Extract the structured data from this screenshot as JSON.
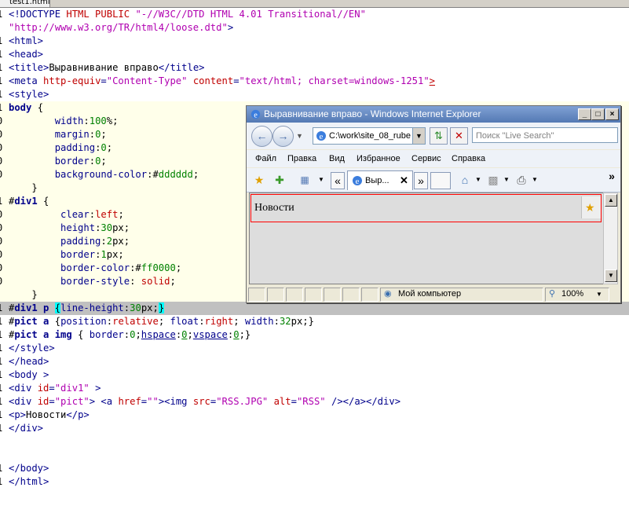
{
  "editor": {
    "tab_label": "test1.html",
    "lines": [
      {
        "n": "1",
        "p": [
          {
            "c": "t",
            "v": "<!DOCTYPE "
          },
          {
            "c": "a",
            "v": "HTML PUBLIC "
          },
          {
            "c": "s",
            "v": "\"-//W3C//DTD HTML 4.01 Transitional//EN\""
          }
        ]
      },
      {
        "n": "",
        "p": [
          {
            "c": "s",
            "v": "\"http://www.w3.org/TR/html4/loose.dtd\""
          },
          {
            "c": "t",
            "v": ">"
          }
        ]
      },
      {
        "n": "1",
        "p": [
          {
            "c": "t",
            "v": "<html>"
          }
        ]
      },
      {
        "n": "1",
        "p": [
          {
            "c": "t",
            "v": "<head>"
          }
        ]
      },
      {
        "n": "1",
        "p": [
          {
            "c": "t",
            "v": "<title>"
          },
          {
            "c": "",
            "v": "Выравнивание вправо"
          },
          {
            "c": "t",
            "v": "</title>"
          }
        ]
      },
      {
        "n": "1",
        "p": [
          {
            "c": "t",
            "v": "<meta "
          },
          {
            "c": "a",
            "v": "http-equiv"
          },
          {
            "c": "t",
            "v": "="
          },
          {
            "c": "s",
            "v": "\"Content-Type\" "
          },
          {
            "c": "a",
            "v": "content"
          },
          {
            "c": "t",
            "v": "="
          },
          {
            "c": "s",
            "v": "\"text/html; charset=windows-1251\""
          },
          {
            "c": "a ul",
            "v": ">"
          }
        ]
      },
      {
        "n": "1",
        "p": [
          {
            "c": "t",
            "v": "<style>"
          }
        ]
      },
      {
        "n": "1",
        "bg": "hlbg",
        "p": [
          {
            "c": "k",
            "v": "body"
          },
          {
            "c": "",
            "v": " {"
          }
        ]
      },
      {
        "n": "0",
        "bg": "hlbg",
        "p": [
          {
            "c": "t",
            "v": "        width"
          },
          {
            "c": "",
            "v": ":"
          },
          {
            "c": "g",
            "v": "100"
          },
          {
            "c": "",
            "v": "%;"
          }
        ]
      },
      {
        "n": "0",
        "bg": "hlbg",
        "p": [
          {
            "c": "t",
            "v": "        margin"
          },
          {
            "c": "",
            "v": ":"
          },
          {
            "c": "g",
            "v": "0"
          },
          {
            "c": "",
            "v": ";"
          }
        ]
      },
      {
        "n": "0",
        "bg": "hlbg",
        "p": [
          {
            "c": "t",
            "v": "        padding"
          },
          {
            "c": "",
            "v": ":"
          },
          {
            "c": "g",
            "v": "0"
          },
          {
            "c": "",
            "v": ";"
          }
        ]
      },
      {
        "n": "0",
        "bg": "hlbg",
        "p": [
          {
            "c": "t",
            "v": "        border"
          },
          {
            "c": "",
            "v": ":"
          },
          {
            "c": "g",
            "v": "0"
          },
          {
            "c": "",
            "v": ";"
          }
        ]
      },
      {
        "n": "0",
        "bg": "hlbg",
        "p": [
          {
            "c": "t",
            "v": "        background-color"
          },
          {
            "c": "",
            "v": ":#"
          },
          {
            "c": "g",
            "v": "dddddd"
          },
          {
            "c": "",
            "v": ";"
          }
        ]
      },
      {
        "n": "",
        "bg": "hlbg",
        "p": [
          {
            "c": "",
            "v": "    }"
          }
        ]
      },
      {
        "n": "1",
        "bg": "hlbg",
        "p": [
          {
            "c": "",
            "v": "#"
          },
          {
            "c": "k",
            "v": "div1"
          },
          {
            "c": "",
            "v": " {"
          }
        ]
      },
      {
        "n": "0",
        "bg": "hlbg",
        "p": [
          {
            "c": "t",
            "v": "         clear"
          },
          {
            "c": "",
            "v": ":"
          },
          {
            "c": "a",
            "v": "left"
          },
          {
            "c": "",
            "v": ";"
          }
        ]
      },
      {
        "n": "0",
        "bg": "hlbg",
        "p": [
          {
            "c": "t",
            "v": "         height"
          },
          {
            "c": "",
            "v": ":"
          },
          {
            "c": "g",
            "v": "30"
          },
          {
            "c": "",
            "v": "px;"
          }
        ]
      },
      {
        "n": "0",
        "bg": "hlbg",
        "p": [
          {
            "c": "t",
            "v": "         padding"
          },
          {
            "c": "",
            "v": ":"
          },
          {
            "c": "g",
            "v": "2"
          },
          {
            "c": "",
            "v": "px;"
          }
        ]
      },
      {
        "n": "0",
        "bg": "hlbg",
        "p": [
          {
            "c": "t",
            "v": "         border"
          },
          {
            "c": "",
            "v": ":"
          },
          {
            "c": "g",
            "v": "1"
          },
          {
            "c": "",
            "v": "px;"
          }
        ]
      },
      {
        "n": "0",
        "bg": "hlbg",
        "p": [
          {
            "c": "t",
            "v": "         border-color"
          },
          {
            "c": "",
            "v": ":#"
          },
          {
            "c": "g",
            "v": "ff0000"
          },
          {
            "c": "",
            "v": ";"
          }
        ]
      },
      {
        "n": "0",
        "bg": "hlbg",
        "p": [
          {
            "c": "t",
            "v": "         border-style"
          },
          {
            "c": "",
            "v": ": "
          },
          {
            "c": "a",
            "v": "solid"
          },
          {
            "c": "",
            "v": ";"
          }
        ]
      },
      {
        "n": "",
        "bg": "hlbg",
        "p": [
          {
            "c": "",
            "v": "    }"
          }
        ]
      },
      {
        "n": "1",
        "bg": "cur",
        "p": [
          {
            "c": "",
            "v": "#"
          },
          {
            "c": "k",
            "v": "div1 p"
          },
          {
            "c": "",
            "v": " "
          },
          {
            "c": "cy",
            "v": "{"
          },
          {
            "c": "t",
            "v": "line-height"
          },
          {
            "c": "",
            "v": ":"
          },
          {
            "c": "g",
            "v": "30"
          },
          {
            "c": "",
            "v": "px;"
          },
          {
            "c": "cy",
            "v": "}"
          }
        ]
      },
      {
        "n": "1",
        "p": [
          {
            "c": "",
            "v": "#"
          },
          {
            "c": "k",
            "v": "pict a"
          },
          {
            "c": "",
            "v": " {"
          },
          {
            "c": "t",
            "v": "position"
          },
          {
            "c": "",
            "v": ":"
          },
          {
            "c": "a",
            "v": "relative"
          },
          {
            "c": "",
            "v": "; "
          },
          {
            "c": "t",
            "v": "float"
          },
          {
            "c": "",
            "v": ":"
          },
          {
            "c": "a",
            "v": "right"
          },
          {
            "c": "",
            "v": "; "
          },
          {
            "c": "t",
            "v": "width"
          },
          {
            "c": "",
            "v": ":"
          },
          {
            "c": "g",
            "v": "32"
          },
          {
            "c": "",
            "v": "px;}"
          }
        ]
      },
      {
        "n": "1",
        "p": [
          {
            "c": "",
            "v": "#"
          },
          {
            "c": "k",
            "v": "pict a img"
          },
          {
            "c": "",
            "v": " { "
          },
          {
            "c": "t",
            "v": "border"
          },
          {
            "c": "",
            "v": ":"
          },
          {
            "c": "g",
            "v": "0"
          },
          {
            "c": "",
            "v": ";"
          },
          {
            "c": "t ul",
            "v": "hspace"
          },
          {
            "c": "",
            "v": ":"
          },
          {
            "c": "g ul",
            "v": "0"
          },
          {
            "c": "",
            "v": ";"
          },
          {
            "c": "t ul",
            "v": "vspace"
          },
          {
            "c": "",
            "v": ":"
          },
          {
            "c": "g ul",
            "v": "0"
          },
          {
            "c": "",
            "v": ";}"
          }
        ]
      },
      {
        "n": "1",
        "p": [
          {
            "c": "t",
            "v": "</style>"
          }
        ]
      },
      {
        "n": "1",
        "p": [
          {
            "c": "t",
            "v": "</head>"
          }
        ]
      },
      {
        "n": "1",
        "p": [
          {
            "c": "t",
            "v": "<body >"
          }
        ]
      },
      {
        "n": "1",
        "p": [
          {
            "c": "t",
            "v": "<div "
          },
          {
            "c": "a",
            "v": "id"
          },
          {
            "c": "t",
            "v": "="
          },
          {
            "c": "s",
            "v": "\"div1\""
          },
          {
            "c": "t",
            "v": " >"
          }
        ]
      },
      {
        "n": "1",
        "p": [
          {
            "c": "t",
            "v": "<div "
          },
          {
            "c": "a",
            "v": "id"
          },
          {
            "c": "t",
            "v": "="
          },
          {
            "c": "s",
            "v": "\"pict\""
          },
          {
            "c": "t",
            "v": "> <a "
          },
          {
            "c": "a",
            "v": "href"
          },
          {
            "c": "t",
            "v": "="
          },
          {
            "c": "s",
            "v": "\"\""
          },
          {
            "c": "t",
            "v": "><img "
          },
          {
            "c": "a",
            "v": "src"
          },
          {
            "c": "t",
            "v": "="
          },
          {
            "c": "s",
            "v": "\"RSS.JPG\" "
          },
          {
            "c": "a",
            "v": "alt"
          },
          {
            "c": "t",
            "v": "="
          },
          {
            "c": "s",
            "v": "\"RSS\""
          },
          {
            "c": "t",
            "v": " /></a></div>"
          }
        ]
      },
      {
        "n": "1",
        "p": [
          {
            "c": "t",
            "v": "<p>"
          },
          {
            "c": "",
            "v": "Новости"
          },
          {
            "c": "t",
            "v": "</p>"
          }
        ]
      },
      {
        "n": "1",
        "p": [
          {
            "c": "t",
            "v": "</div>"
          }
        ]
      },
      {
        "n": "",
        "p": []
      },
      {
        "n": "",
        "p": []
      },
      {
        "n": "1",
        "p": [
          {
            "c": "t",
            "v": "</body>"
          }
        ]
      },
      {
        "n": "1",
        "p": [
          {
            "c": "t",
            "v": "</html>"
          }
        ]
      }
    ]
  },
  "browser": {
    "title": "Выравнивание вправо - Windows Internet Explorer",
    "window_buttons": [
      "_",
      "□",
      "×"
    ],
    "back_icon": "back-arrow-icon",
    "forward_icon": "forward-arrow-icon",
    "address": "C:\\work\\site_08_rube",
    "search_placeholder": "Поиск \"Live Search\"",
    "menu": [
      "Файл",
      "Правка",
      "Вид",
      "Избранное",
      "Сервис",
      "Справка"
    ],
    "tab_label": "Выр...",
    "chevron": "»",
    "page_text": "Новости",
    "status_zone": "Мой компьютер",
    "zoom": "100%",
    "colors": {
      "title_bar": "#5479b4",
      "div_border": "#ff0000",
      "page_bg": "#dddddd"
    }
  }
}
